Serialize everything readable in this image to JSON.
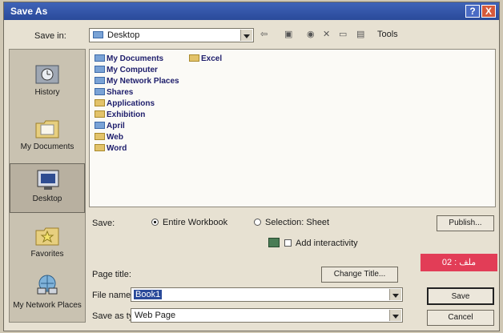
{
  "window": {
    "title": "Save As",
    "help": "?",
    "close": "X"
  },
  "save_in": {
    "label": "Save in:",
    "value": "Desktop"
  },
  "toolbar": {
    "back": "⇦",
    "up": "▣",
    "search": "◉",
    "delete": "✕",
    "new_folder": "▭",
    "views": "▤",
    "tools": "Tools"
  },
  "places": [
    {
      "label": "History"
    },
    {
      "label": "My Documents"
    },
    {
      "label": "Desktop"
    },
    {
      "label": "Favorites"
    },
    {
      "label": "My Network Places"
    }
  ],
  "files": [
    {
      "name": "My Documents",
      "icon": "folder-icon"
    },
    {
      "name": "My Computer",
      "icon": "computer-icon"
    },
    {
      "name": "My Network Places",
      "icon": "network-icon"
    },
    {
      "name": "Shares",
      "icon": "folder-icon"
    },
    {
      "name": "Applications",
      "icon": "folder-icon"
    },
    {
      "name": "Exhibition",
      "icon": "folder-icon"
    },
    {
      "name": "April",
      "icon": "folder-icon"
    },
    {
      "name": "Web",
      "icon": "folder-icon"
    },
    {
      "name": "Word",
      "icon": "folder-icon"
    },
    {
      "name": "Excel",
      "icon": "folder-icon"
    }
  ],
  "save_options": {
    "label": "Save:",
    "entire_workbook": "Entire Workbook",
    "selection": "Selection: Sheet",
    "interactivity": "Add interactivity",
    "publish": "Publish..."
  },
  "page_title": {
    "label": "Page title:",
    "change_button": "Change Title..."
  },
  "file_name": {
    "label": "File name:",
    "value": "Book1"
  },
  "save_as_type": {
    "label": "Save as type:",
    "value": "Web Page"
  },
  "buttons": {
    "save": "Save",
    "cancel": "Cancel"
  },
  "badge": {
    "text": "ملف :  02"
  }
}
